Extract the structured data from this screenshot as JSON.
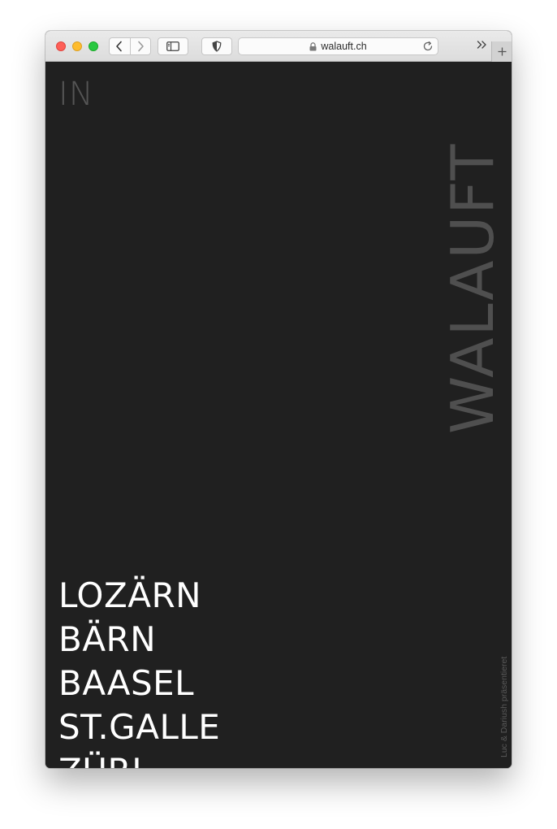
{
  "browser": {
    "url": "walauft.ch"
  },
  "page": {
    "intro": "IN",
    "brand": "WALAUFT",
    "cities": [
      "LOZÄRN",
      "BÄRN",
      "BAASEL",
      "ST.GALLE",
      "ZÜRI"
    ],
    "credit": "Luc & Dariush präsentieret"
  },
  "colors": {
    "page_background": "#202020",
    "city_text": "#ffffff",
    "muted_text": "#555555"
  }
}
